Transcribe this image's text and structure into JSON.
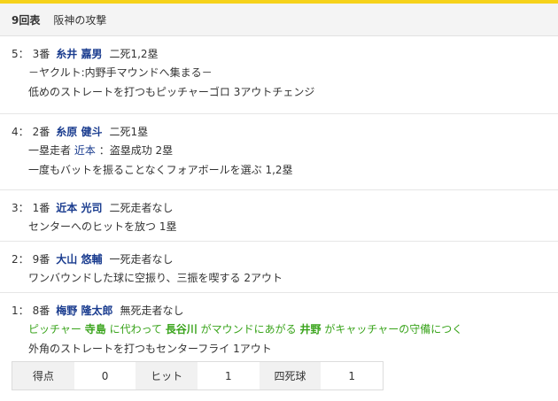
{
  "header": {
    "inning": "9回表",
    "team": "阪神の攻撃"
  },
  "entries": [
    {
      "outs": "5：",
      "order": "3番",
      "batter": "糸井 嘉男",
      "situation": "二死1,2塁",
      "lines": [
        "－ヤクルト:内野手マウンドへ集まる－",
        "低めのストレートを打つもピッチャーゴロ 3アウトチェンジ"
      ]
    },
    {
      "outs": "4：",
      "order": "2番",
      "batter": "糸原 健斗",
      "situation": "二死1塁",
      "runner_line": {
        "prefix": "一塁走者",
        "runner": "近本",
        "suffix": "：盗塁成功 2塁"
      },
      "lines": [
        "一度もバットを振ることなくフォアボールを選ぶ 1,2塁"
      ]
    },
    {
      "outs": "3：",
      "order": "1番",
      "batter": "近本 光司",
      "situation": "二死走者なし",
      "lines": [
        "センターへのヒットを放つ 1塁"
      ]
    },
    {
      "outs": "2：",
      "order": "9番",
      "batter": "大山 悠輔",
      "situation": "一死走者なし",
      "lines": [
        "ワンバウンドした球に空振り、三振を喫する 2アウト"
      ]
    },
    {
      "outs": "1：",
      "order": "8番",
      "batter": "梅野 隆太郎",
      "situation": "無死走者なし",
      "change": {
        "t1": "ピッチャー",
        "p1": "寺島",
        "t2": "に代わって",
        "p2": "長谷川",
        "t3": "がマウンドにあがる",
        "p3": "井野",
        "t4": "がキャッチャーの守備につく"
      },
      "lines": [
        "外角のストレートを打つもセンターフライ 1アウト"
      ]
    }
  ],
  "summary": {
    "runs_label": "得点",
    "runs": "0",
    "hits_label": "ヒット",
    "hits": "1",
    "walks_label": "四死球",
    "walks": "1"
  },
  "colors": {
    "accent": "#f6d21a",
    "name": "#1a3c8f",
    "change": "#3aa41c"
  }
}
